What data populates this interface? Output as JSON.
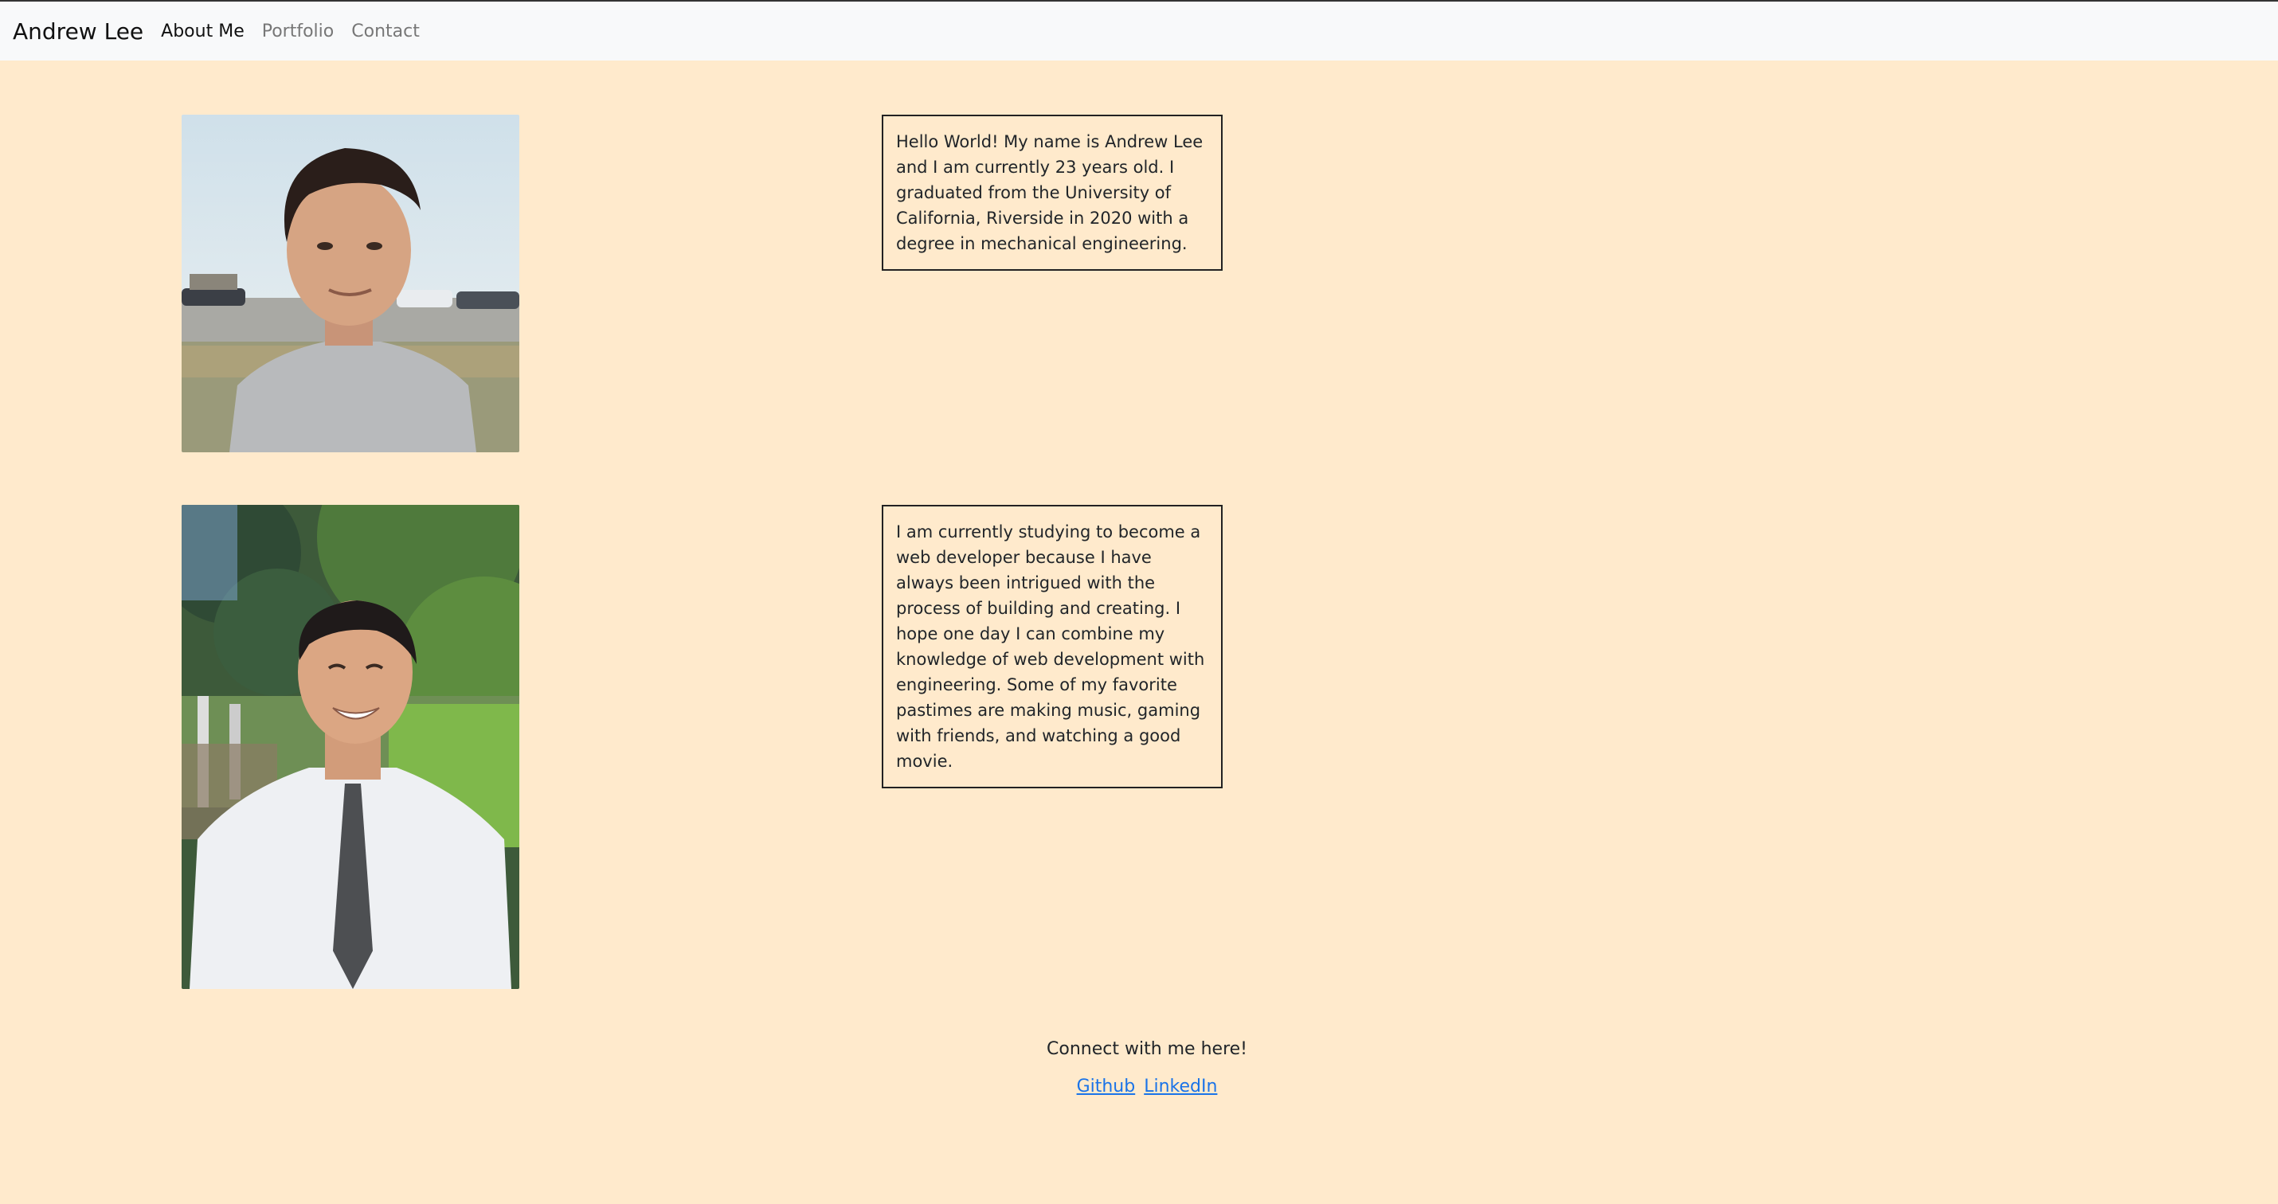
{
  "navbar": {
    "brand": "Andrew Lee",
    "links": [
      {
        "label": "About Me",
        "active": true
      },
      {
        "label": "Portfolio",
        "active": false
      },
      {
        "label": "Contact",
        "active": false
      }
    ]
  },
  "sections": [
    {
      "photo": "portrait-gray-shirt",
      "text": "Hello World! My name is Andrew Lee and I am currently 23 years old. I graduated from the University of California, Riverside in 2020 with a degree in mechanical engineering."
    },
    {
      "photo": "portrait-white-shirt-tie",
      "text": "I am currently studying to become a web developer because I have always been intrigued with the process of building and creating. I hope one day I can combine my knowledge of web development with engineering. Some of my favorite pastimes are making music, gaming with friends, and watching a good movie."
    }
  ],
  "footer": {
    "connect_text": "Connect with me here!",
    "links": [
      "Github",
      "LinkedIn"
    ]
  },
  "colors": {
    "page_background": "#ffeacc",
    "navbar_background": "#f8f9fa",
    "link": "#1a73e8"
  }
}
